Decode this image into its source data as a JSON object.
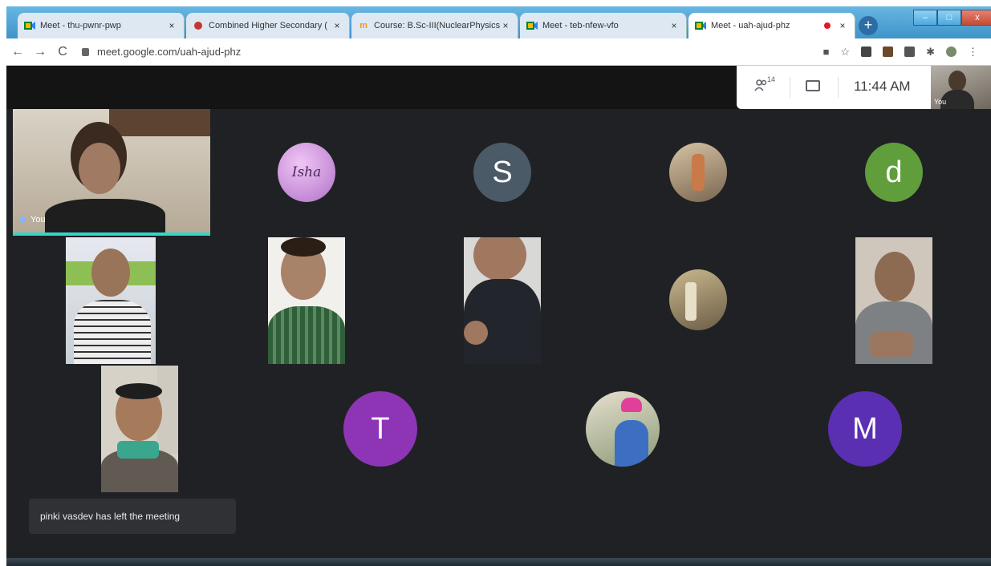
{
  "browser": {
    "tabs": [
      {
        "label": "Meet - thu-pwnr-pwp",
        "favicon": "meet-icon",
        "active": false
      },
      {
        "label": "Combined Higher Secondary (",
        "favicon": "record-icon",
        "active": false
      },
      {
        "label": "Course: B.Sc-III(NuclearPhysics)",
        "favicon": "moodle-icon",
        "active": false
      },
      {
        "label": "Meet - teb-nfew-vfo",
        "favicon": "meet-icon",
        "active": false
      },
      {
        "label": "Meet - uah-ajud-phz",
        "favicon": "meet-icon",
        "active": true,
        "recording": true
      }
    ],
    "new_tab": "+",
    "window_controls": {
      "minimize": "–",
      "maximize": "□",
      "close": "x"
    },
    "url": "meet.google.com/uah-ajud-phz",
    "nav": {
      "back": "←",
      "forward": "→",
      "reload": "C"
    }
  },
  "meet": {
    "participants_count": "14",
    "clock": "11:44 AM",
    "self_thumb_label": "You",
    "self_tile_label": "You",
    "tiles": [
      {
        "type": "avatar",
        "text": "Isha",
        "color": "#c98bd8"
      },
      {
        "type": "avatar",
        "text": "S",
        "color": "#4a5a66"
      },
      {
        "type": "avatar-photo",
        "text": ""
      },
      {
        "type": "avatar",
        "text": "d",
        "color": "#5f9e3a"
      },
      {
        "type": "avatar",
        "text": "T",
        "color": "#8e35b6"
      },
      {
        "type": "avatar",
        "text": "M",
        "color": "#5a2fb2"
      }
    ],
    "toast": "pinki vasdev has left the meeting"
  }
}
